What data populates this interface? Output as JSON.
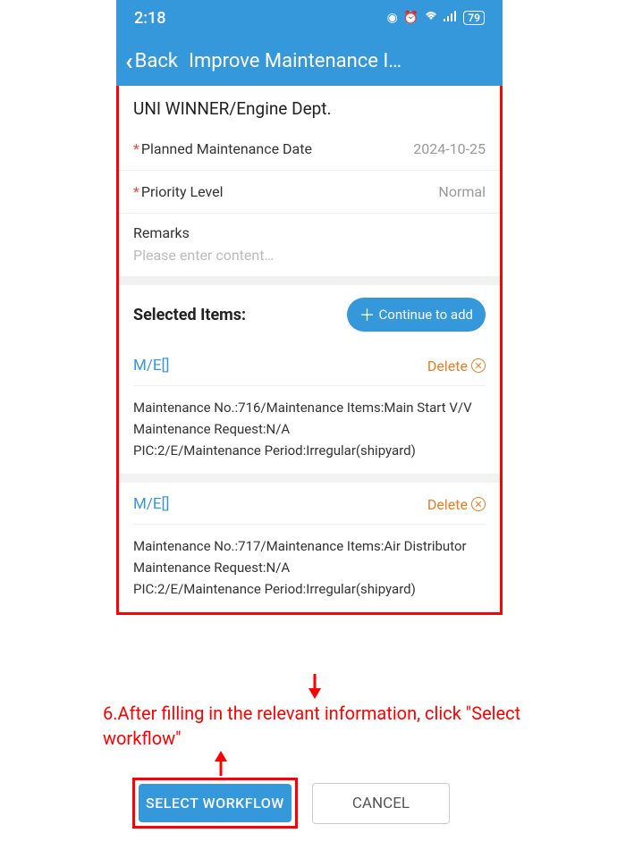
{
  "statusBar": {
    "time": "2:18",
    "battery": "79"
  },
  "nav": {
    "back": "Back",
    "title": "Improve Maintenance I…"
  },
  "header": {
    "title": "UNI WINNER/Engine Dept."
  },
  "form": {
    "plannedDateLabel": "Planned Maintenance Date",
    "plannedDateValue": "2024-10-25",
    "priorityLabel": "Priority Level",
    "priorityValue": "Normal",
    "remarksLabel": "Remarks",
    "remarksPlaceholder": "Please enter content…"
  },
  "selectedItems": {
    "title": "Selected Items:",
    "continueBtn": "Continue to add",
    "deleteLabel": "Delete",
    "items": [
      {
        "code": "M/E[]",
        "line1": "Maintenance No.:716/Maintenance Items:Main Start V/V",
        "line2": "Maintenance Request:N/A",
        "line3": "PIC:2/E/Maintenance Period:Irregular(shipyard)"
      },
      {
        "code": "M/E[]",
        "line1": "Maintenance No.:717/Maintenance Items:Air Distributor",
        "line2": "Maintenance Request:N/A",
        "line3": "PIC:2/E/Maintenance Period:Irregular(shipyard)"
      }
    ]
  },
  "annotation": {
    "text": "6.After filling in the relevant information, click \"Select workflow\""
  },
  "buttons": {
    "selectWorkflow": "SELECT WORKFLOW",
    "cancel": "CANCEL"
  }
}
